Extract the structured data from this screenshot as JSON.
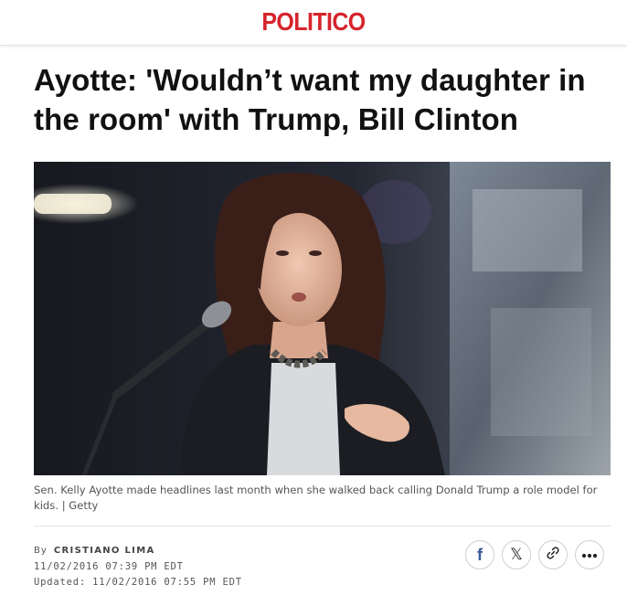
{
  "header": {
    "logo": "POLITICO"
  },
  "article": {
    "headline": "Ayotte: 'Wouldn’t want my daughter in the room' with Trump, Bill Clinton",
    "caption": "Sen. Kelly Ayotte made headlines last month when she walked back calling Donald Trump a role model for kids. | Getty",
    "byline": {
      "by_label": "By",
      "author": "CRISTIANO LIMA",
      "published": "11/02/2016 07:39 PM EDT",
      "updated": "Updated: 11/02/2016 07:55 PM EDT"
    }
  },
  "share": [
    {
      "icon": "facebook-icon",
      "glyph": "f"
    },
    {
      "icon": "x-icon",
      "glyph": "𝕏"
    },
    {
      "icon": "link-icon",
      "glyph": ""
    },
    {
      "icon": "more-icon",
      "glyph": ""
    }
  ],
  "colors": {
    "brand_red": "#d6242c",
    "facebook_blue": "#3b5998",
    "text": "#111111",
    "muted": "#555555"
  }
}
